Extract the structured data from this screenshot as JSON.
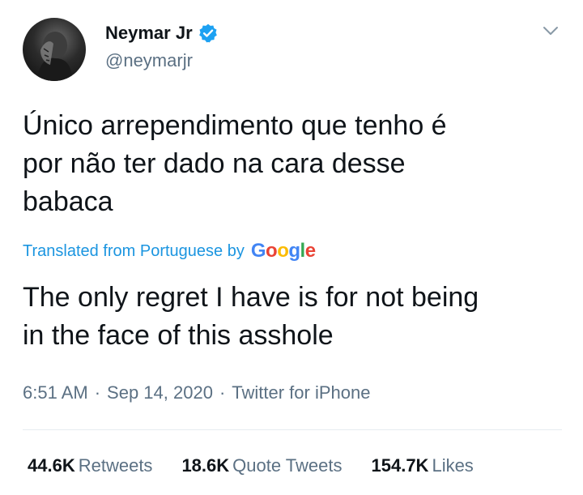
{
  "user": {
    "display_name": "Neymar Jr",
    "handle": "@neymarjr"
  },
  "tweet": {
    "text_line1": "Único arrependimento que tenho é",
    "text_line2": "por não ter dado na cara desse",
    "text_line3": "babaca",
    "translated_label": "Translated from Portuguese by",
    "translation_provider": "Google",
    "translation_line1": "The only regret I have is for not being",
    "translation_line2": "in the face of this asshole",
    "time": "6:51 AM",
    "date": "Sep 14, 2020",
    "source": "Twitter for iPhone",
    "separator": "·"
  },
  "stats": {
    "retweets_count": "44.6K",
    "retweets_label": "Retweets",
    "quotes_count": "18.6K",
    "quotes_label": "Quote Tweets",
    "likes_count": "154.7K",
    "likes_label": "Likes"
  },
  "icons": {
    "verified": "verified-badge-icon",
    "menu": "chevron-down-icon"
  },
  "colors": {
    "link_blue": "#1b95e0",
    "verified_blue": "#1da1f2",
    "secondary_text": "#5b7083",
    "primary_text": "#0f1419"
  }
}
